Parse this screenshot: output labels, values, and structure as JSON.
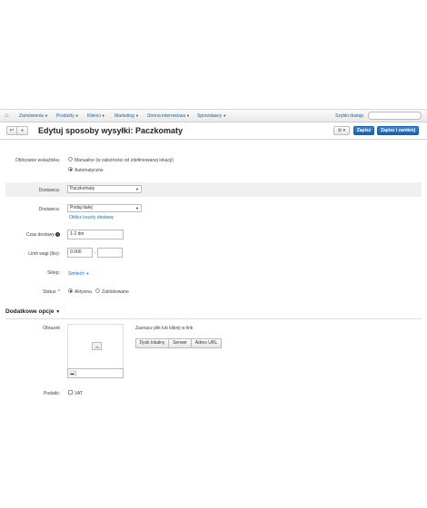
{
  "nav": {
    "items": [
      {
        "label": "Zamówienia"
      },
      {
        "label": "Produkty"
      },
      {
        "label": "Klienci"
      },
      {
        "label": "Marketing"
      },
      {
        "label": "Strona internetowa"
      },
      {
        "label": "Sprzedawcy"
      }
    ],
    "quick_access": "Szybki dostęp",
    "search_placeholder": ""
  },
  "header": {
    "title": "Edytuj sposoby wysyłki: Paczkomaty",
    "save": "Zapisz",
    "save_close": "Zapisz i zamknij"
  },
  "form": {
    "rate_calc_label": "Obliczanie wskaźnika:",
    "rate_manual": "Manualne (w zależności od zdefiniowanej lokacji)",
    "rate_auto": "Automatyczne",
    "carrier_label": "Dostawca:",
    "carrier_value": "Paczkomaty",
    "service_label": "Dostawca:",
    "service_value": "Podaj dalej",
    "calc_link": "Oblicz koszty dostawy",
    "delivery_time_label": "Czas dostawy",
    "delivery_time_value": "1-2 dni",
    "weight_label": "Limit wagi (lbs):",
    "weight_min": "0.000",
    "weight_sep": "-",
    "weight_max": "",
    "store_label": "Sklep:",
    "store_value": "Simtech",
    "status_label": "Status:",
    "status_required": "*",
    "status_active": "Aktywna",
    "status_disabled": "Zablokowane"
  },
  "extra": {
    "section_title": "Dodatkowe opcje",
    "image_label": "Obrazek",
    "image_hint": "Zaznacz plik lub kliknij w link",
    "btn_local": "Dysk lokalny",
    "btn_server": "Serwer",
    "btn_url": "Adres URL",
    "alt_value": "",
    "taxes_label": "Podatki:",
    "tax_vat": "VAT"
  }
}
